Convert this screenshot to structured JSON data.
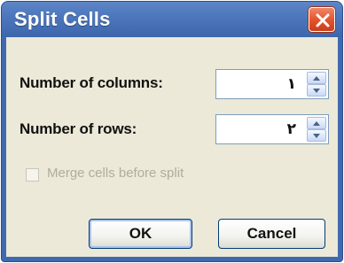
{
  "dialog": {
    "title": "Split Cells"
  },
  "columns": {
    "label": "Number of columns:",
    "value": "١"
  },
  "rows": {
    "label": "Number of rows:",
    "value": "٢"
  },
  "merge": {
    "label": "Merge cells before split",
    "checked": false,
    "disabled": true
  },
  "buttons": {
    "ok": "OK",
    "cancel": "Cancel"
  },
  "colors": {
    "titlebar": "#4c76bb",
    "close_button": "#e4562f",
    "client": "#ece9d8"
  },
  "icons": {
    "close": "close-icon",
    "spin_up": "arrow-up-icon",
    "spin_down": "arrow-down-icon"
  }
}
